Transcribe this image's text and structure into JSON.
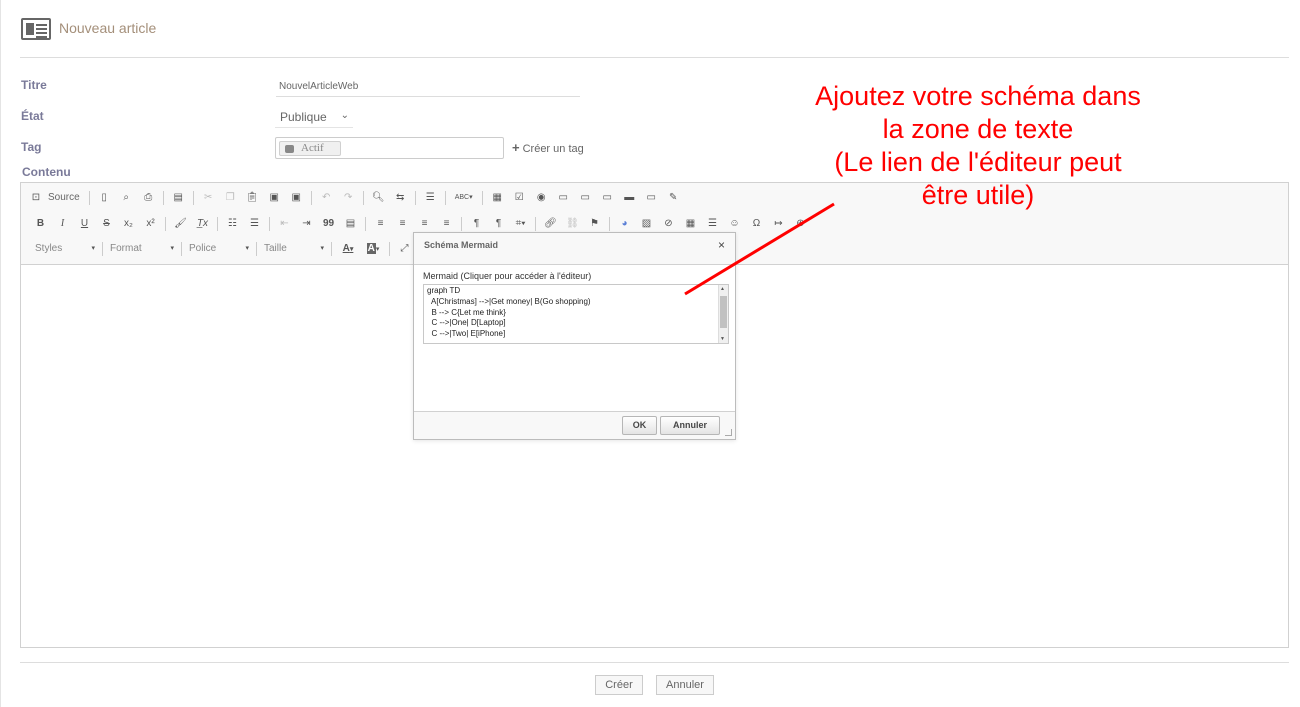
{
  "header": {
    "title": "Nouveau article",
    "icon": "newspaper-icon"
  },
  "form": {
    "title_label": "Titre",
    "title_value": "NouvelArticleWeb",
    "state_label": "État",
    "state_value": "Publique",
    "tag_label": "Tag",
    "tag_chip": "Actif",
    "create_tag": "Créer un tag",
    "content_label": "Contenu"
  },
  "toolbar": {
    "source_label": "Source",
    "styles": "Styles",
    "format": "Format",
    "font": "Police",
    "size": "Taille",
    "glyphs": {
      "bold": "B",
      "italic": "I",
      "underline": "U",
      "strike": "S",
      "subscript": "x₂",
      "superscript": "x²",
      "clear": "T̲x",
      "quote": "99",
      "special_char": "Ω",
      "text_color": "A",
      "bg_color": "A",
      "abc": "ABC"
    }
  },
  "dialog": {
    "title": "Schéma Mermaid",
    "close": "×",
    "label": "Mermaid (Cliquer pour accéder à l'éditeur)",
    "code": "graph TD\n  A[Christmas] -->|Get money| B(Go shopping)\n  B --> C{Let me think}\n  C -->|One| D[Laptop]\n  C -->|Two| E[iPhone]",
    "ok": "OK",
    "cancel": "Annuler"
  },
  "annotation": {
    "text": "Ajoutez votre schéma dans\nla zone de texte\n(Le lien de l'éditeur peut\nêtre utile)",
    "color": "#ff0000"
  },
  "actions": {
    "create": "Créer",
    "cancel": "Annuler"
  }
}
